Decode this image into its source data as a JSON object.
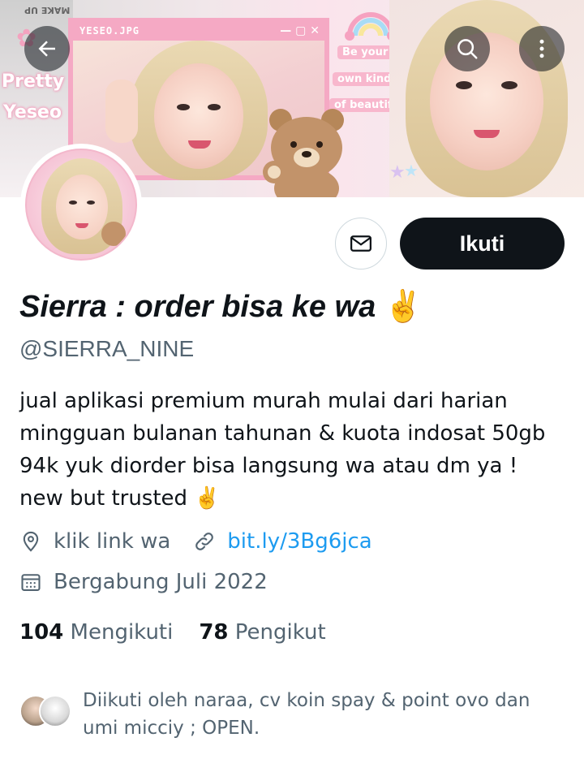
{
  "banner": {
    "window_title": "YESEO.JPG",
    "window_buttons": "— ▢ ✕",
    "sticker_pretty": "Pretty",
    "sticker_yeseo": "Yeseo",
    "pill_1": "Be your",
    "pill_2": "own kind",
    "pill_3": "of beautiful",
    "corner_text": "MAKE UP"
  },
  "nav": {
    "back_icon": "arrow-left-icon",
    "search_icon": "search-icon",
    "more_icon": "more-vertical-icon"
  },
  "profile": {
    "display_name": "Sierra : order bisa ke wa",
    "display_name_emoji": "✌️",
    "handle": "@SIERRA_NINE",
    "bio_lines": [
      "jual aplikasi premium murah mulai dari harian",
      "mingguan bulanan tahunan & kuota indosat 50gb",
      "94k yuk diorder bisa langsung wa atau dm ya !",
      "new but trusted ✌️"
    ],
    "location": "klik link wa",
    "website": "bit.ly/3Bg6jca",
    "joined": "Bergabung Juli 2022",
    "following_count": "104",
    "following_label": "Mengikuti",
    "followers_count": "78",
    "followers_label": "Pengikut",
    "followed_by_lines": [
      "Diikuti oleh naraa, cv koin spay & point ovo dan",
      "umi micciy ; OPEN."
    ]
  },
  "actions": {
    "follow_label": "Ikuti",
    "message_icon": "envelope-icon"
  },
  "colors": {
    "text_primary": "#0f1419",
    "text_secondary": "#536471",
    "link": "#1d9bf0",
    "follow_bg": "#0f1419",
    "banner_pink": "#f5a9c4"
  }
}
